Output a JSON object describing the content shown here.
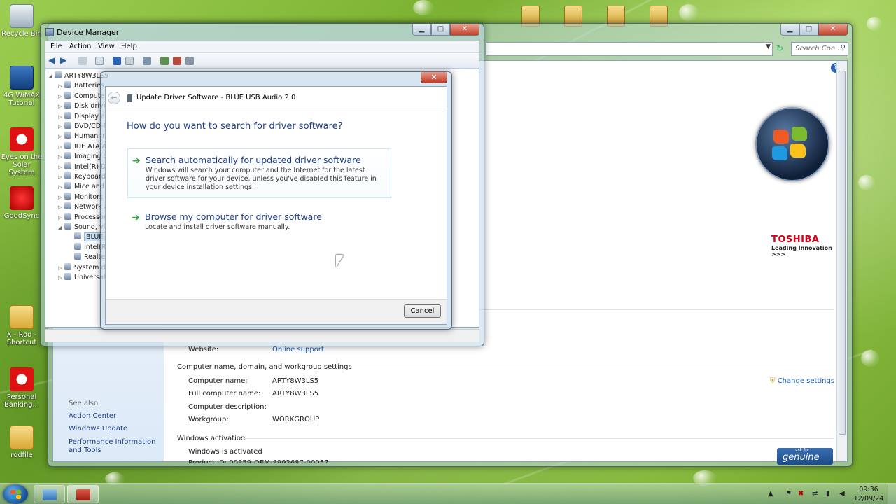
{
  "desktop": {
    "icons": [
      {
        "label": "Recycle Bin"
      },
      {
        "label": "4G WiMAX Tutorial"
      },
      {
        "label": "Eyes on the Solar System"
      },
      {
        "label": "GoodSync"
      },
      {
        "label": "X - Rod - Shortcut"
      },
      {
        "label": "Personal Banking..."
      },
      {
        "label": "rodfile"
      }
    ]
  },
  "system_window": {
    "search_placeholder": "Search Con...",
    "website_label": "Website:",
    "website_value": "Online support",
    "section_computer": "Computer name, domain, and workgroup settings",
    "computer_name_label": "Computer name:",
    "computer_name_value": "ARTY8W3LS5",
    "full_name_label": "Full computer name:",
    "full_name_value": "ARTY8W3LS5",
    "description_label": "Computer description:",
    "workgroup_label": "Workgroup:",
    "workgroup_value": "WORKGROUP",
    "change_settings": "Change settings",
    "section_activation": "Windows activation",
    "activation_status": "Windows is activated",
    "product_id": "Product ID: 00359-OEM-8992687-00057",
    "see_also": "See also",
    "links": [
      "Action Center",
      "Windows Update",
      "Performance Information and Tools"
    ],
    "toshiba_brand": "TOSHIBA",
    "toshiba_tag": "Leading Innovation >>>",
    "genuine_small": "ask for",
    "genuine": "genuine"
  },
  "device_manager": {
    "title": "Device Manager",
    "menu": [
      "File",
      "Action",
      "View",
      "Help"
    ],
    "tree": [
      {
        "label": "ARTY8W3LS5",
        "expander": "◢",
        "level": 0
      },
      {
        "label": "Batteries",
        "expander": "▷",
        "level": 1
      },
      {
        "label": "Computer",
        "expander": "▷",
        "level": 1
      },
      {
        "label": "Disk drives",
        "expander": "▷",
        "level": 1
      },
      {
        "label": "Display adapters",
        "expander": "▷",
        "level": 1
      },
      {
        "label": "DVD/CD-ROM drives",
        "expander": "▷",
        "level": 1
      },
      {
        "label": "Human Interface Devices",
        "expander": "▷",
        "level": 1
      },
      {
        "label": "IDE ATA/ATAPI controllers",
        "expander": "▷",
        "level": 1
      },
      {
        "label": "Imaging devices",
        "expander": "▷",
        "level": 1
      },
      {
        "label": "Intel(R) Dynamic Platform",
        "expander": "▷",
        "level": 1
      },
      {
        "label": "Keyboards",
        "expander": "▷",
        "level": 1
      },
      {
        "label": "Mice and other pointing devices",
        "expander": "▷",
        "level": 1
      },
      {
        "label": "Monitors",
        "expander": "▷",
        "level": 1
      },
      {
        "label": "Network adapters",
        "expander": "▷",
        "level": 1
      },
      {
        "label": "Processors",
        "expander": "▷",
        "level": 1
      },
      {
        "label": "Sound, video and game controllers",
        "expander": "◢",
        "level": 1
      },
      {
        "label": "BLUE USB Audio 2.0",
        "expander": "",
        "level": 2,
        "selected": true
      },
      {
        "label": "Intel(R) Display Audio",
        "expander": "",
        "level": 2
      },
      {
        "label": "Realtek High Definition Audio",
        "expander": "",
        "level": 2
      },
      {
        "label": "System devices",
        "expander": "▷",
        "level": 1
      },
      {
        "label": "Universal Serial Bus controllers",
        "expander": "▷",
        "level": 1
      }
    ]
  },
  "dialog": {
    "title": "Update Driver Software - BLUE USB Audio 2.0",
    "question": "How do you want to search for driver software?",
    "option1_title": "Search automatically for updated driver software",
    "option1_desc": "Windows will search your computer and the Internet for the latest driver software for your device, unless you've disabled this feature in your device installation settings.",
    "option2_title": "Browse my computer for driver software",
    "option2_desc": "Locate and install driver software manually.",
    "cancel": "Cancel"
  },
  "taskbar": {
    "time": "09:36",
    "date": "12/09/24"
  }
}
